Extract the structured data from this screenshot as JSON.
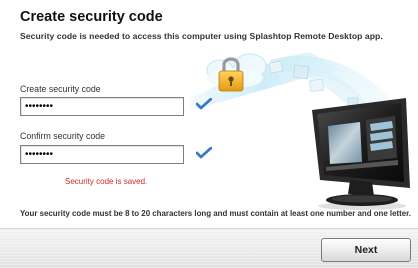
{
  "header": {
    "title": "Create security code",
    "subtitle": "Security code is needed to access this computer using Splashtop Remote Desktop app."
  },
  "form": {
    "create": {
      "label": "Create security code",
      "value": "********"
    },
    "confirm": {
      "label": "Confirm security code",
      "value": "********"
    },
    "status_message": "Security code is saved."
  },
  "info_text": "Your security code must be 8 to 20 characters long and must contain at least one number and one letter.",
  "footer": {
    "next_label": "Next"
  },
  "icons": {
    "create_check": "checkmark-icon",
    "confirm_check": "checkmark-icon",
    "illustration": "cloud-lock-to-monitor-illustration"
  },
  "colors": {
    "accent_check": "#3a78c9",
    "status_text": "#cc2b2b",
    "lock_gold": "#f0b323"
  }
}
